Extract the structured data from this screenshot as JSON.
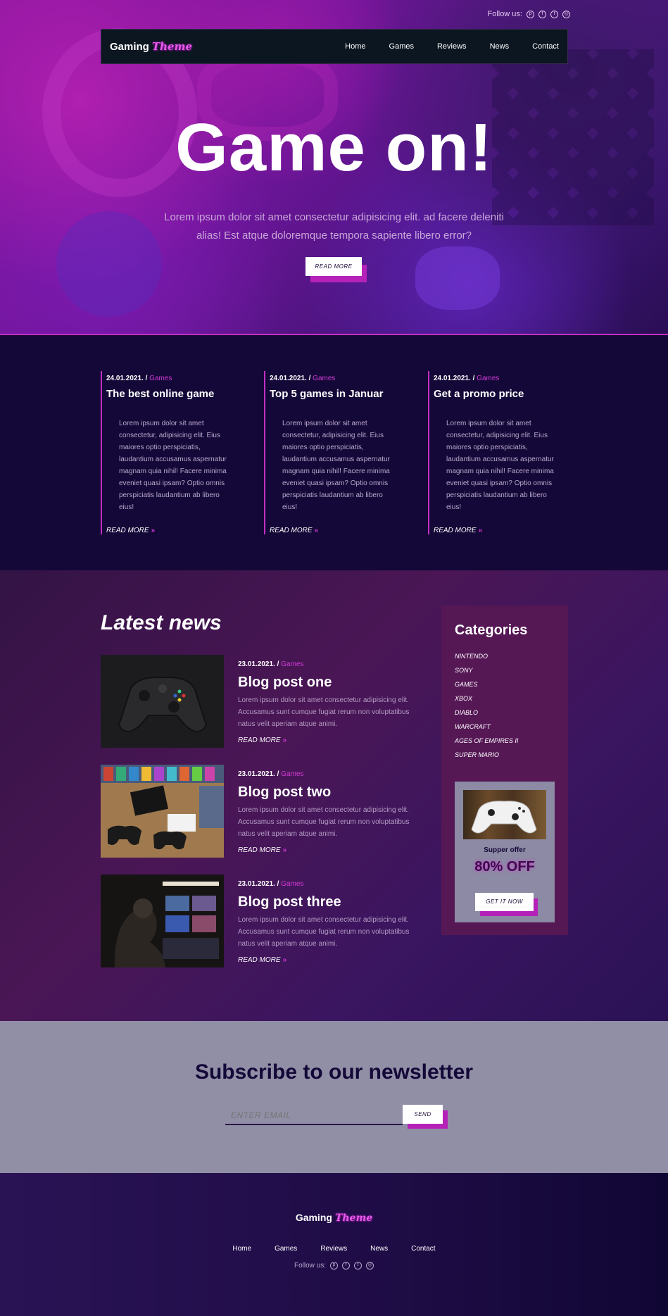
{
  "header": {
    "follow_label": "Follow us:",
    "social_icons": [
      "pinterest-icon",
      "facebook-icon",
      "twitter-icon",
      "dribbble-icon"
    ],
    "logo_word": "Gaming",
    "logo_accent": "Theme",
    "nav": [
      "Home",
      "Games",
      "Reviews",
      "News",
      "Contact"
    ]
  },
  "hero": {
    "title": "Game on!",
    "text": "Lorem ipsum dolor sit amet consectetur adipisicing elit. ad facere deleniti alias! Est atque doloremque tempora sapiente libero error?",
    "button": "READ MORE"
  },
  "features": [
    {
      "date": "24.01.2021. /",
      "category": "Games",
      "title": "The best online game",
      "text": "Lorem ipsum dolor sit amet consectetur, adipisicing elit. Eius maiores optio perspiciatis, laudantium accusamus aspernatur magnam quia nihil! Facere minima eveniet quasi ipsam? Optio omnis perspiciatis laudantium ab libero eius!",
      "link": "READ MORE"
    },
    {
      "date": "24.01.2021. /",
      "category": "Games",
      "title": "Top 5 games in Januar",
      "text": "Lorem ipsum dolor sit amet consectetur, adipisicing elit. Eius maiores optio perspiciatis, laudantium accusamus aspernatur magnam quia nihil! Facere minima eveniet quasi ipsam? Optio omnis perspiciatis laudantium ab libero eius!",
      "link": "READ MORE"
    },
    {
      "date": "24.01.2021. /",
      "category": "Games",
      "title": "Get a promo price",
      "text": "Lorem ipsum dolor sit amet consectetur, adipisicing elit. Eius maiores optio perspiciatis, laudantium accusamus aspernatur magnam quia nihil! Facere minima eveniet quasi ipsam? Optio omnis perspiciatis laudantium ab libero eius!",
      "link": "READ MORE"
    }
  ],
  "latest": {
    "title": "Latest news",
    "posts": [
      {
        "date": "23.01.2021. /",
        "category": "Games",
        "title": "Blog post one",
        "text": "Lorem ipsum dolor sit amet consectetur adipisicing elit. Accusamus sunt cumque fugiat rerum non voluptatibus natus velit aperiam atque animi.",
        "link": "READ MORE"
      },
      {
        "date": "23.01.2021. /",
        "category": "Games",
        "title": "Blog post two",
        "text": "Lorem ipsum dolor sit amet consectetur adipisicing elit. Accusamus sunt cumque fugiat rerum non voluptatibus natus velit aperiam atque animi.",
        "link": "READ MORE"
      },
      {
        "date": "23.01.2021. /",
        "category": "Games",
        "title": "Blog post three",
        "text": "Lorem ipsum dolor sit amet consectetur adipisicing elit. Accusamus sunt cumque fugiat rerum non voluptatibus natus velit aperiam atque animi.",
        "link": "READ MORE"
      }
    ]
  },
  "sidebar": {
    "title": "Categories",
    "categories": [
      "NINTENDO",
      "SONY",
      "GAMES",
      "XBOX",
      "DIABLO",
      "WARCRAFT",
      "AGES OF EMPIRES II",
      "SUPER MARIO"
    ],
    "offer_title": "Supper offer",
    "offer_discount": "80% OFF",
    "offer_button": "GET IT NOW"
  },
  "newsletter": {
    "title": "Subscribe to our newsletter",
    "placeholder": "ENTER EMAIL",
    "button": "SEND"
  },
  "footer": {
    "logo_word": "Gaming",
    "logo_accent": "Theme",
    "nav": [
      "Home",
      "Games",
      "Reviews",
      "News",
      "Contact"
    ],
    "follow_label": "Follow us:"
  },
  "colors": {
    "accent": "#c42fc2",
    "dark": "#140838",
    "newsletter_bg": "#918fa6"
  }
}
